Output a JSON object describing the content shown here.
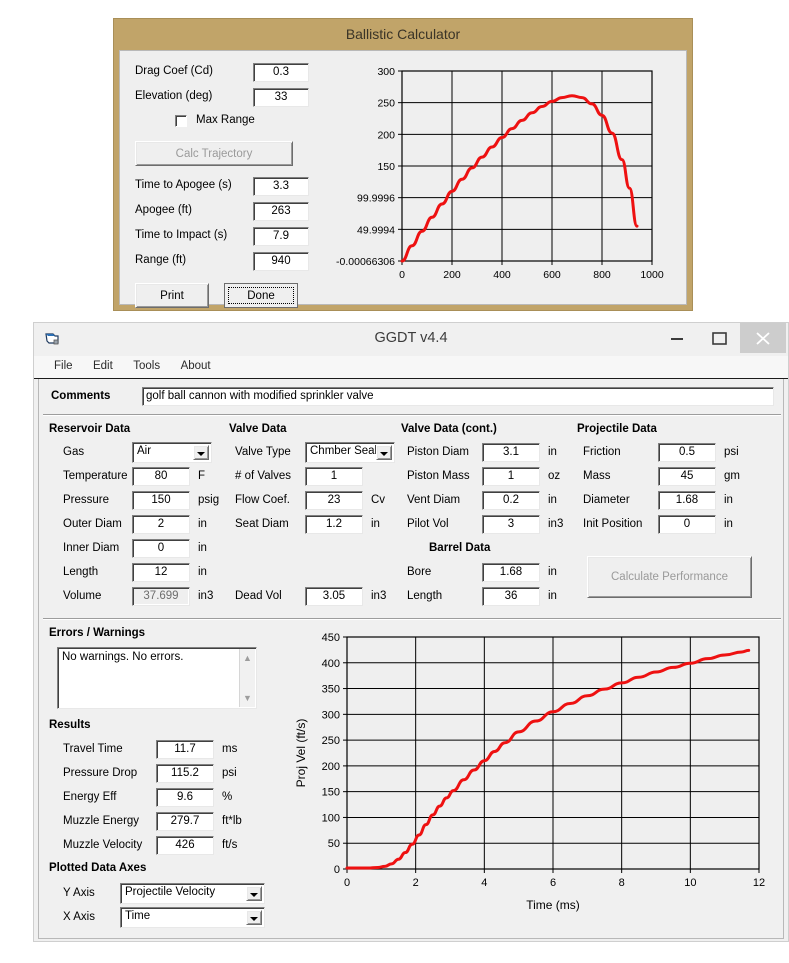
{
  "ballistic": {
    "title": "Ballistic Calculator",
    "fields": [
      {
        "label": "Drag Coef (Cd)",
        "value": "0.3"
      },
      {
        "label": "Elevation (deg)",
        "value": "33"
      }
    ],
    "checkbox": {
      "label": "Max Range",
      "checked": false
    },
    "calc_button": "Calc Trajectory",
    "results": [
      {
        "label": "Time to Apogee (s)",
        "value": "3.3"
      },
      {
        "label": "Apogee (ft)",
        "value": "263"
      },
      {
        "label": "Time to Impact (s)",
        "value": "7.9"
      },
      {
        "label": "Range (ft)",
        "value": "940"
      }
    ],
    "print_button": "Print",
    "done_button": "Done",
    "chart_data": {
      "type": "line",
      "title": "",
      "xlabel": "",
      "ylabel": "",
      "xlim": [
        0,
        1000
      ],
      "ylim": [
        -0.00066306,
        300
      ],
      "xticks": [
        0,
        200,
        400,
        600,
        800,
        1000
      ],
      "xticklabels": [
        "0",
        "200",
        "400",
        "600",
        "800",
        "1000"
      ],
      "yticks": [
        -0.00066306,
        49.9994,
        99.9996,
        150,
        200,
        250,
        300
      ],
      "yticklabels": [
        "-0.00066306",
        "49.9994",
        "99.9996",
        "150",
        "200",
        "250",
        "300"
      ],
      "grid": true,
      "series": [
        {
          "name": "Trajectory",
          "color": "#ee1111",
          "x": [
            0,
            40,
            80,
            120,
            160,
            200,
            240,
            280,
            320,
            360,
            400,
            440,
            480,
            520,
            560,
            600,
            640,
            680,
            720,
            760,
            800,
            840,
            880,
            910,
            940
          ],
          "y": [
            0,
            24,
            47,
            69,
            90,
            110,
            129,
            147,
            164,
            180,
            195,
            209,
            222,
            234,
            244,
            252,
            258,
            261,
            258,
            248,
            230,
            202,
            160,
            115,
            55
          ]
        }
      ]
    }
  },
  "ggdt": {
    "title": "GGDT v4.4",
    "window_buttons": {
      "minimize": "minimize-icon",
      "maximize": "maximize-icon",
      "close": "close-icon"
    },
    "menu": [
      "File",
      "Edit",
      "Tools",
      "About"
    ],
    "comments": {
      "label": "Comments",
      "value": "golf ball cannon with modified sprinkler valve"
    },
    "reservoir": {
      "title": "Reservoir Data",
      "gas": {
        "label": "Gas",
        "value": "Air"
      },
      "rows": [
        {
          "label": "Temperature",
          "value": "80",
          "unit": "F",
          "readonly": false
        },
        {
          "label": "Pressure",
          "value": "150",
          "unit": "psig",
          "readonly": false
        },
        {
          "label": "Outer Diam",
          "value": "2",
          "unit": "in",
          "readonly": false
        },
        {
          "label": "Inner Diam",
          "value": "0",
          "unit": "in",
          "readonly": false
        },
        {
          "label": "Length",
          "value": "12",
          "unit": "in",
          "readonly": false
        },
        {
          "label": "Volume",
          "value": "37.699",
          "unit": "in3",
          "readonly": true
        }
      ]
    },
    "valve": {
      "title": "Valve Data",
      "valve_type": {
        "label": "Valve Type",
        "value": "Chmber Seal"
      },
      "rows": [
        {
          "label": "# of Valves",
          "value": "1",
          "unit": ""
        },
        {
          "label": "Flow Coef.",
          "value": "23",
          "unit": "Cv"
        },
        {
          "label": "Seat Diam",
          "value": "1.2",
          "unit": "in"
        }
      ],
      "dead_vol": {
        "label": "Dead Vol",
        "value": "3.05",
        "unit": "in3"
      }
    },
    "valve_cont": {
      "title": "Valve Data (cont.)",
      "rows": [
        {
          "label": "Piston Diam",
          "value": "3.1",
          "unit": "in"
        },
        {
          "label": "Piston Mass",
          "value": "1",
          "unit": "oz"
        },
        {
          "label": "Vent Diam",
          "value": "0.2",
          "unit": "in"
        },
        {
          "label": "Pilot Vol",
          "value": "3",
          "unit": "in3"
        }
      ],
      "barrel_title": "Barrel Data",
      "barrel_rows": [
        {
          "label": "Bore",
          "value": "1.68",
          "unit": "in"
        },
        {
          "label": "Length",
          "value": "36",
          "unit": "in"
        }
      ]
    },
    "projectile": {
      "title": "Projectile Data",
      "rows": [
        {
          "label": "Friction",
          "value": "0.5",
          "unit": "psi"
        },
        {
          "label": "Mass",
          "value": "45",
          "unit": "gm"
        },
        {
          "label": "Diameter",
          "value": "1.68",
          "unit": "in"
        },
        {
          "label": "Init Position",
          "value": "0",
          "unit": "in"
        }
      ],
      "calculate_button": "Calculate Performance"
    },
    "errors": {
      "title": "Errors / Warnings",
      "text": "No warnings.  No errors."
    },
    "results": {
      "title": "Results",
      "rows": [
        {
          "label": "Travel Time",
          "value": "11.7",
          "unit": "ms"
        },
        {
          "label": "Pressure Drop",
          "value": "115.2",
          "unit": "psi"
        },
        {
          "label": "Energy Eff",
          "value": "9.6",
          "unit": "%"
        },
        {
          "label": "Muzzle Energy",
          "value": "279.7",
          "unit": "ft*lb"
        },
        {
          "label": "Muzzle Velocity",
          "value": "426",
          "unit": "ft/s"
        }
      ]
    },
    "axes": {
      "title": "Plotted Data Axes",
      "y_axis": {
        "label": "Y Axis",
        "value": "Projectile Velocity"
      },
      "x_axis": {
        "label": "X Axis",
        "value": "Time"
      }
    },
    "chart_data": {
      "type": "line",
      "title": "",
      "xlabel": "Time (ms)",
      "ylabel": "Proj Vel (ft/s)",
      "xlim": [
        0,
        12
      ],
      "ylim": [
        0,
        450
      ],
      "xticks": [
        0,
        2,
        4,
        6,
        8,
        10,
        12
      ],
      "xticklabels": [
        "0",
        "2",
        "4",
        "6",
        "8",
        "10",
        "12"
      ],
      "yticks": [
        0,
        50,
        100,
        150,
        200,
        250,
        300,
        350,
        400,
        450
      ],
      "yticklabels": [
        "0",
        "50",
        "100",
        "150",
        "200",
        "250",
        "300",
        "350",
        "400",
        "450"
      ],
      "grid": true,
      "series": [
        {
          "name": "Projectile Velocity",
          "color": "#ee1111",
          "x": [
            0,
            0.3,
            0.6,
            0.9,
            1.1,
            1.3,
            1.5,
            1.7,
            1.9,
            2.1,
            2.3,
            2.5,
            2.7,
            2.9,
            3.1,
            3.4,
            3.7,
            4.0,
            4.3,
            4.6,
            5.0,
            5.5,
            6.0,
            6.5,
            7.0,
            7.5,
            8.0,
            8.5,
            9.0,
            9.5,
            10.0,
            10.5,
            11.0,
            11.5,
            11.7
          ],
          "y": [
            2,
            2,
            2,
            3,
            5,
            10,
            19,
            32,
            48,
            66,
            86,
            105,
            122,
            138,
            152,
            173,
            192,
            210,
            228,
            245,
            266,
            287,
            305,
            321,
            336,
            349,
            361,
            372,
            382,
            391,
            399,
            408,
            415,
            421,
            424
          ]
        }
      ]
    }
  }
}
